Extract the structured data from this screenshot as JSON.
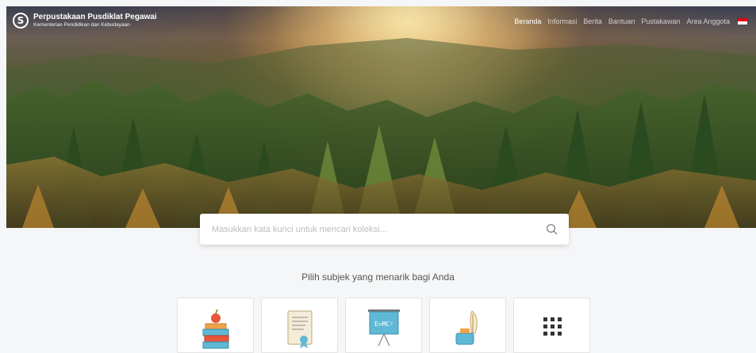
{
  "brand": {
    "title": "Perpustakaan Pusdiklat Pegawai",
    "subtitle": "Kementerian Pendidikan dan Kebudayaan",
    "logo_icon": "s-circle-logo"
  },
  "nav": {
    "items": [
      "Beranda",
      "Informasi",
      "Berita",
      "Bantuan",
      "Pustakawan",
      "Area Anggota"
    ],
    "active": "Beranda",
    "language_flag": "indonesia-flag-icon",
    "flag_colors": [
      "#e2001a",
      "#ffffff"
    ]
  },
  "search": {
    "placeholder": "Masukkan kata kunci untuk mencari koleksi...",
    "value": "",
    "icon": "search-icon"
  },
  "tagline": "Pilih subjek yang menarik bagi Anda",
  "subjects": [
    {
      "icon": "books-apple-icon"
    },
    {
      "icon": "certificate-scroll-icon"
    },
    {
      "icon": "blackboard-emc2-icon",
      "text": "E=MC²"
    },
    {
      "icon": "inkwell-quill-icon"
    },
    {
      "icon": "grid-dots-icon"
    }
  ],
  "colors": {
    "background": "#f5f6f7",
    "card_border": "#e3e3e3",
    "icon_accent": "#5fb9d6",
    "icon_orange": "#f0a24a"
  }
}
